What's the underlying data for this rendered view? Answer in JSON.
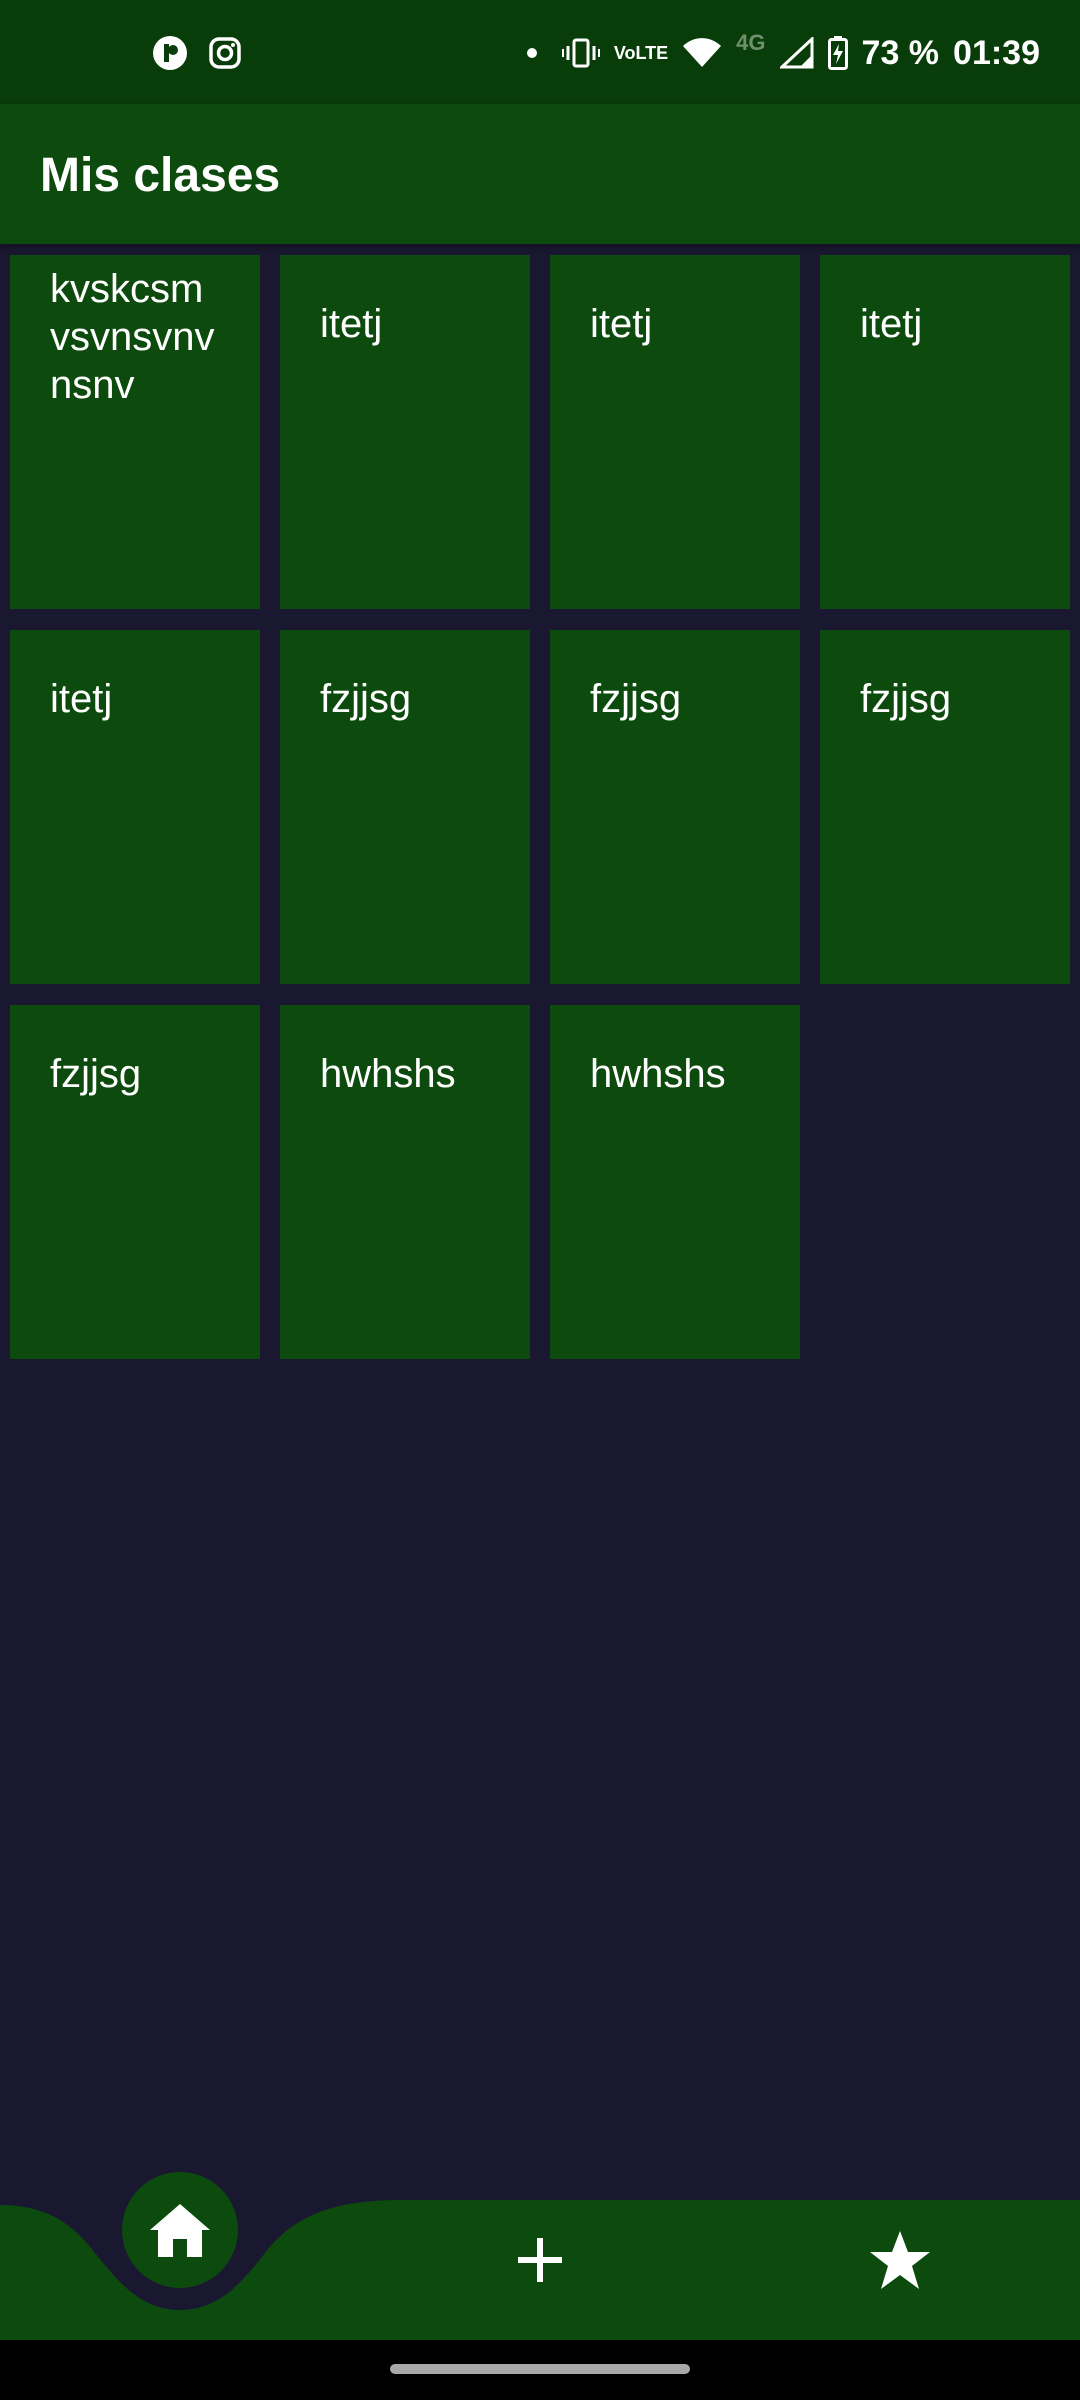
{
  "status_bar": {
    "battery": "73 %",
    "time": "01:39",
    "network": "4G",
    "volte_top": "Vo",
    "volte_bottom": "LTE",
    "icons": [
      "app-notification-icon",
      "instagram-icon",
      "dot-icon",
      "vibrate-icon",
      "volte-icon",
      "wifi-icon",
      "signal-icon",
      "battery-charging-icon"
    ]
  },
  "app_bar": {
    "title": "Mis clases"
  },
  "classes": [
    "kvskcsm vsvnsvnv nsnv",
    "itetj",
    "itetj",
    "itetj",
    "itetj",
    "fzjjsg",
    "fzjjsg",
    "fzjjsg",
    "fzjjsg",
    "hwhshs",
    "hwhshs"
  ],
  "bottom_nav": {
    "items": [
      {
        "icon": "home-icon",
        "active": true
      },
      {
        "icon": "plus-icon",
        "active": false
      },
      {
        "icon": "star-icon",
        "active": false
      }
    ]
  },
  "colors": {
    "background": "#1a1830",
    "primary": "#0d4a0d",
    "status_bar": "#083c08",
    "text": "#ffffff"
  }
}
